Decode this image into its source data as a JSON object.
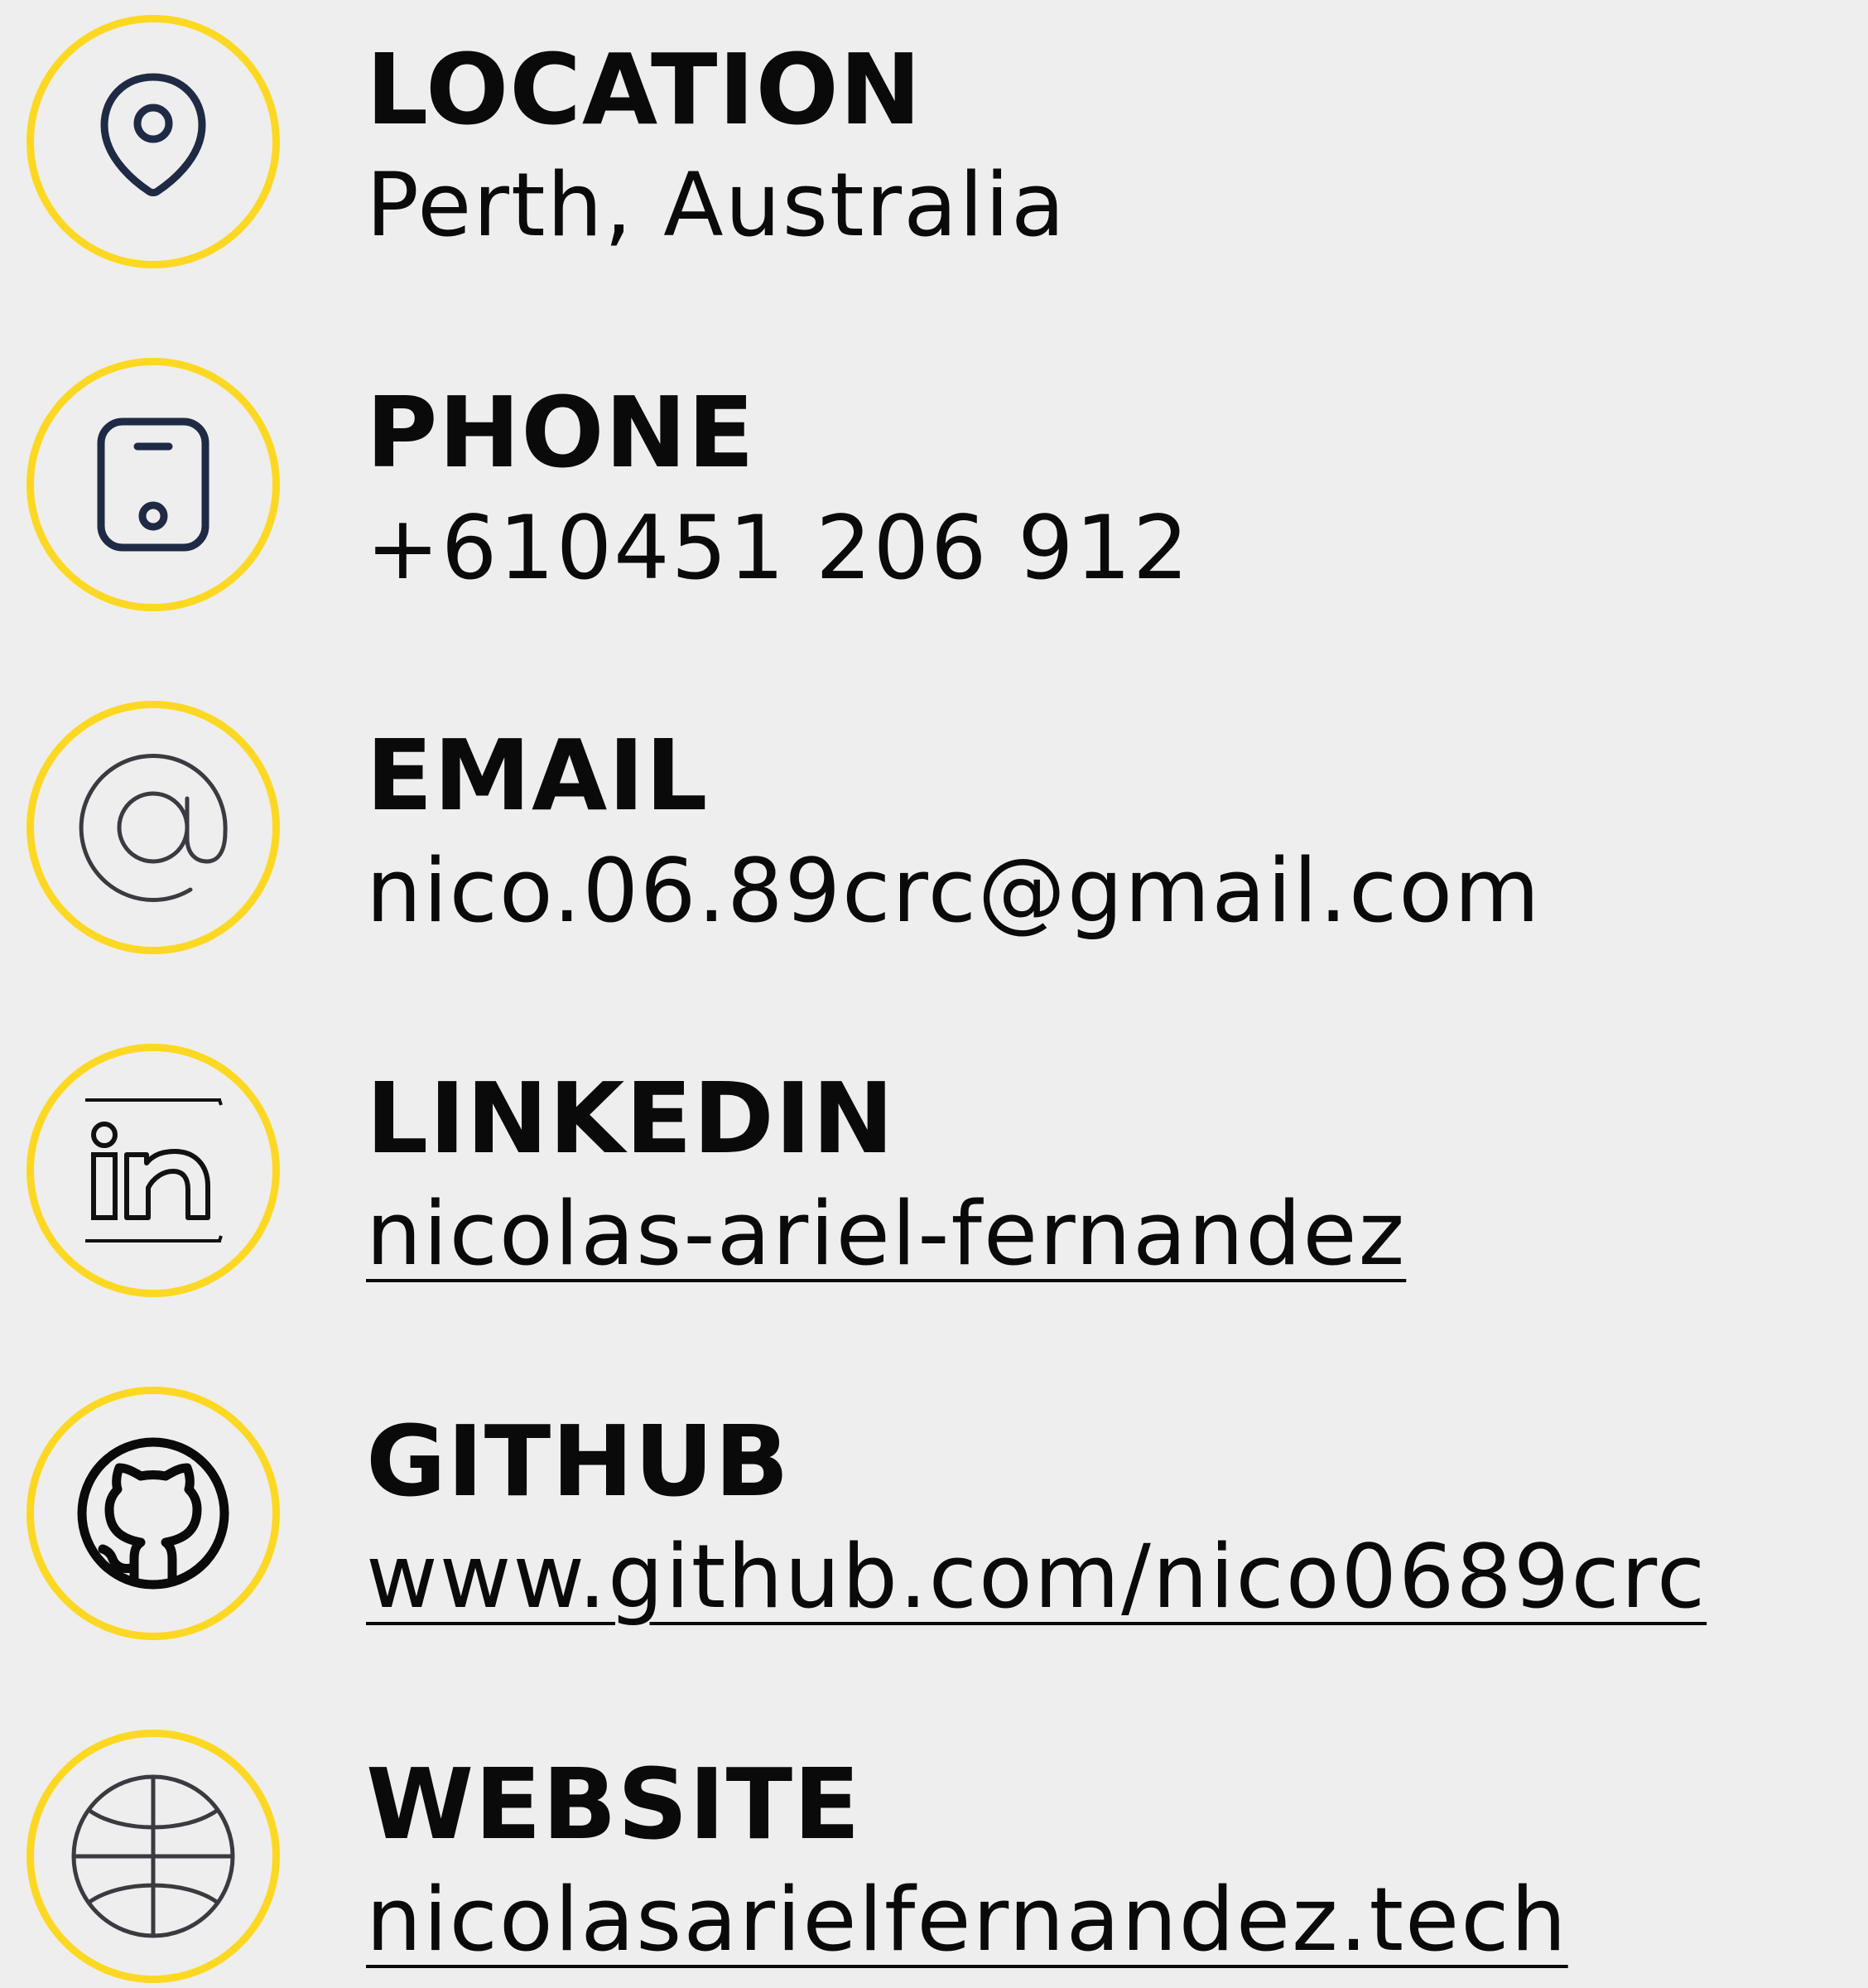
{
  "colors": {
    "background": "#eeeeee",
    "ring": "#fdd823",
    "icon_navy": "#1f2a44",
    "icon_gray": "#3a3a40",
    "text": "#0a0a0a"
  },
  "contacts": [
    {
      "label": "LOCATION",
      "value": "Perth, Australia",
      "icon": "map-pin-icon",
      "link": false
    },
    {
      "label": "PHONE",
      "value": "+610451 206 912",
      "icon": "mobile-phone-icon",
      "link": false
    },
    {
      "label": "EMAIL",
      "value": "nico.06.89crc@gmail.com",
      "icon": "at-sign-icon",
      "link": false
    },
    {
      "label": "LINKEDIN",
      "value": "nicolas-ariel-fernandez",
      "icon": "linkedin-icon",
      "link": true
    },
    {
      "label": "GITHUB",
      "value": "www.github.com/nico0689crc",
      "icon": "github-icon",
      "link": true
    },
    {
      "label": "WEBSITE",
      "value": "nicolasarielfernandez.tech",
      "icon": "globe-icon",
      "link": true
    }
  ]
}
